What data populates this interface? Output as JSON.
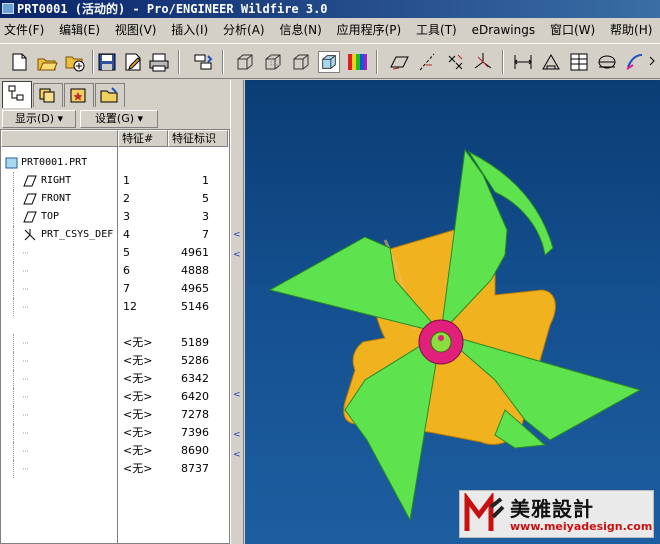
{
  "window": {
    "title": "PRT0001 (活动的) - Pro/ENGINEER Wildfire 3.0"
  },
  "menu": {
    "items": [
      "文件(F)",
      "编辑(E)",
      "视图(V)",
      "插入(I)",
      "分析(A)",
      "信息(N)",
      "应用程序(P)",
      "工具(T)",
      "eDrawings",
      "窗口(W)",
      "帮助(H)"
    ]
  },
  "toolbar": {
    "icons": [
      "new-file-icon",
      "open-file-icon",
      "open-session-icon",
      "save-icon",
      "edit-icon",
      "print-icon",
      "regenerate-icon",
      "wireframe-icon",
      "hidden-line-icon",
      "no-hidden-icon",
      "shading-icon",
      "color-icon",
      "datum-plane-icon",
      "datum-axis-icon",
      "datum-point-icon",
      "coordsys-icon",
      "measure-icon",
      "sketch-icon",
      "table-icon",
      "view-icon",
      "render-icon"
    ]
  },
  "tabs": [
    "model-tree-icon",
    "layer-tree-icon",
    "favorites-icon",
    "folder-icon"
  ],
  "tree_controls": {
    "show_label": "显示(D) ▾",
    "settings_label": "设置(G) ▾"
  },
  "tree_columns": {
    "name": "",
    "feature_num": "特征#",
    "feature_id": "特征标识"
  },
  "tree_rows": [
    {
      "name": "PRT0001.PRT",
      "num": "",
      "id": ""
    },
    {
      "name": "RIGHT",
      "num": "1",
      "id": "1"
    },
    {
      "name": "FRONT",
      "num": "2",
      "id": "5"
    },
    {
      "name": "TOP",
      "num": "3",
      "id": "3"
    },
    {
      "name": "PRT_CSYS_DEF",
      "num": "4",
      "id": "7"
    },
    {
      "name": "",
      "num": "5",
      "id": "4961"
    },
    {
      "name": "",
      "num": "6",
      "id": "4888"
    },
    {
      "name": "",
      "num": "7",
      "id": "4965"
    },
    {
      "name": "",
      "num": "12",
      "id": "5146"
    },
    {
      "name": "",
      "num": "<无>",
      "id": "5189"
    },
    {
      "name": "",
      "num": "<无>",
      "id": "5286"
    },
    {
      "name": "",
      "num": "<无>",
      "id": "6342"
    },
    {
      "name": "",
      "num": "<无>",
      "id": "6420"
    },
    {
      "name": "",
      "num": "<无>",
      "id": "7278"
    },
    {
      "name": "",
      "num": "<无>",
      "id": "7396"
    },
    {
      "name": "",
      "num": "<无>",
      "id": "8690"
    },
    {
      "name": "",
      "num": "<无>",
      "id": "8737"
    }
  ],
  "colors": {
    "blade": "#5ee24e",
    "body": "#f0b21f",
    "hub": "#e0207a",
    "center": "#8adf3e"
  },
  "watermark": {
    "title": "美雅設計",
    "url": "www.meiyadesign.com"
  }
}
